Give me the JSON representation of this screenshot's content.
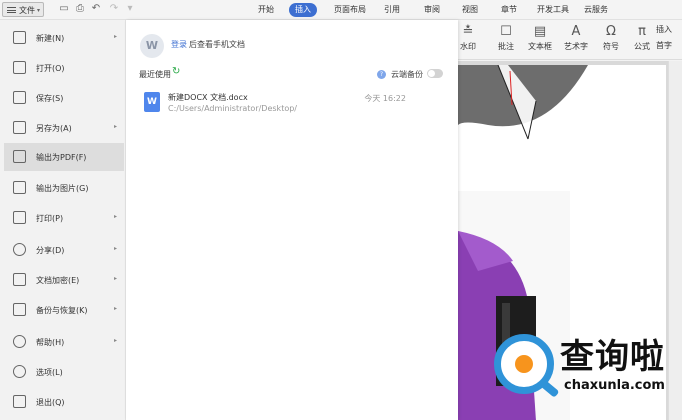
{
  "toolbar": {
    "file_label": "文件",
    "quick_icons": [
      "save-icon",
      "print-icon",
      "undo-icon",
      "redo-icon",
      "more-icon"
    ],
    "tabs": [
      {
        "label": "开始",
        "active": false
      },
      {
        "label": "插入",
        "active": true
      },
      {
        "label": "页面布局",
        "active": false
      },
      {
        "label": "引用",
        "active": false
      },
      {
        "label": "审阅",
        "active": false
      },
      {
        "label": "视图",
        "active": false
      },
      {
        "label": "章节",
        "active": false
      },
      {
        "label": "开发工具",
        "active": false
      },
      {
        "label": "云服务",
        "active": false
      }
    ]
  },
  "ribbon": {
    "watermark": "水印",
    "comment": "批注",
    "textbox": "文本框",
    "wordart": "艺术字",
    "symbol": "符号",
    "formula": "公式",
    "insert": "插入",
    "dropcap": "首字"
  },
  "file_menu": {
    "items": [
      {
        "label": "新建(N)",
        "icon": "new-doc-icon",
        "has_submenu": true
      },
      {
        "label": "打开(O)",
        "icon": "open-folder-icon",
        "has_submenu": false
      },
      {
        "label": "保存(S)",
        "icon": "save-icon",
        "has_submenu": false
      },
      {
        "label": "另存为(A)",
        "icon": "save-as-icon",
        "has_submenu": true
      },
      {
        "label": "输出为PDF(F)",
        "icon": "export-pdf-icon",
        "has_submenu": false,
        "highlighted": true
      },
      {
        "label": "输出为图片(G)",
        "icon": "export-image-icon",
        "has_submenu": false
      },
      {
        "label": "打印(P)",
        "icon": "print-icon",
        "has_submenu": true
      },
      {
        "label": "分享(D)",
        "icon": "share-icon",
        "has_submenu": true
      },
      {
        "label": "文档加密(E)",
        "icon": "encrypt-icon",
        "has_submenu": true
      },
      {
        "label": "备份与恢复(K)",
        "icon": "backup-icon",
        "has_submenu": true
      },
      {
        "label": "帮助(H)",
        "icon": "help-icon",
        "has_submenu": true
      },
      {
        "label": "选项(L)",
        "icon": "gear-icon",
        "has_submenu": false
      },
      {
        "label": "退出(Q)",
        "icon": "exit-icon",
        "has_submenu": false
      }
    ]
  },
  "recent_panel": {
    "login_link": "登录",
    "login_text": "后查看手机文档",
    "recent_label": "最近使用",
    "cloud_backup_label": "云端备份",
    "cloud_backup_on": false,
    "files": [
      {
        "name": "新建DOCX 文档.docx",
        "path": "C:/Users/Administrator/Desktop/",
        "time": "今天 16:22"
      }
    ]
  },
  "watermark_site": {
    "cn": "查询啦",
    "en": "chaxunla.com"
  },
  "colors": {
    "accent": "#3d6fd1",
    "word_icon": "#4f86ec",
    "refresh": "#27a845",
    "photo_purple": "#8a3fb3"
  }
}
